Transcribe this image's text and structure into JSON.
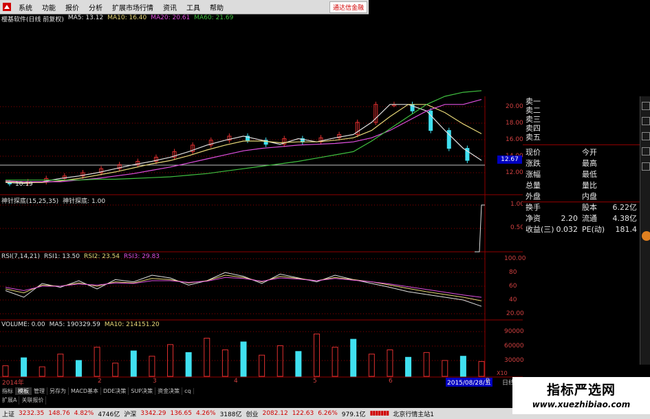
{
  "menu": {
    "items": [
      "系统",
      "功能",
      "报价",
      "分析",
      "扩展市场行情",
      "资讯",
      "工具",
      "帮助"
    ],
    "brand": "通达信金融"
  },
  "main": {
    "title": "樱基软件(日线 前复权)",
    "ma": [
      {
        "label": "MA5: 13.12",
        "color": "#e0e0e0"
      },
      {
        "label": "MA10: 16.40",
        "color": "#e8d878"
      },
      {
        "label": "MA20: 20.61",
        "color": "#e050e0"
      },
      {
        "label": "MA60: 21.69",
        "color": "#40c040"
      }
    ],
    "price_ticks": [
      "20.00",
      "18.00",
      "16.00",
      "14.00",
      "12.00"
    ],
    "current_price": "12.67",
    "low_label": "10.19"
  },
  "indicator1": {
    "title": "神针探底(15,25,35)",
    "value_label": "神针探底: 1.00",
    "ticks": [
      "1.00",
      "0.50"
    ]
  },
  "rsi": {
    "title": "RSI(7,14,21)",
    "rsi1": "RSI1: 13.50",
    "rsi2": "RSI2: 23.54",
    "rsi3": "RSI3: 29.83",
    "ticks": [
      "100.00",
      "80",
      "60",
      "40",
      "20.00"
    ]
  },
  "volume": {
    "title": "VOLUME: 0.00",
    "ma5": "MA5: 190329.59",
    "ma10": "MA10: 214151.20",
    "ticks": [
      "90000",
      "60000",
      "30000"
    ],
    "unit": "X10"
  },
  "xaxis": {
    "labels": [
      "2014年",
      "2",
      "3",
      "4",
      "5",
      "6"
    ],
    "date": "2015/08/28/五",
    "d": "B",
    "day": "日线"
  },
  "orderbook": {
    "labels": [
      "卖一",
      "卖二",
      "卖三",
      "卖四",
      "卖五"
    ]
  },
  "quote": {
    "rows": [
      {
        "l1": "现价",
        "v1": "",
        "l2": "今开",
        "v2": ""
      },
      {
        "l1": "涨跌",
        "v1": "",
        "l2": "最高",
        "v2": ""
      },
      {
        "l1": "涨幅",
        "v1": "",
        "l2": "最低",
        "v2": ""
      },
      {
        "l1": "总量",
        "v1": "",
        "l2": "量比",
        "v2": ""
      },
      {
        "l1": "外盘",
        "v1": "",
        "l2": "内盘",
        "v2": ""
      },
      {
        "l1": "换手",
        "v1": "",
        "l2": "股本",
        "v2": "6.22亿"
      },
      {
        "l1": "净资",
        "v1": "2.20",
        "l2": "流通",
        "v2": "4.38亿"
      },
      {
        "l1": "收益(三)",
        "v1": "0.032",
        "l2": "PE(动)",
        "v2": "181.4"
      }
    ]
  },
  "tabs": {
    "row1": [
      "指标",
      "模板",
      "管理",
      "另存为",
      "MACD基本",
      "DDE决策",
      "SUP决策",
      "资金决策",
      "cq"
    ],
    "active": "模板",
    "row2": [
      "扩展A",
      "关联报价"
    ]
  },
  "status": {
    "items": [
      {
        "name": "上证",
        "value": "3232.35",
        "chg": "148.76",
        "pct": "4.82%",
        "vol": "4746亿"
      },
      {
        "name": "沪深",
        "value": "3342.29",
        "chg": "136.65",
        "pct": "4.26%",
        "vol": "3188亿"
      },
      {
        "name": "创业",
        "value": "2082.12",
        "chg": "122.63",
        "pct": "6.26%",
        "vol": "979.1亿"
      }
    ],
    "server": "北京行情主站1"
  },
  "watermark": {
    "title": "指标严选网",
    "url": "www.xuezhibiao.com"
  },
  "colors": {
    "up": "#e03030",
    "down": "#40e0f0",
    "ma60": "#40c040",
    "ma20": "#e050e0",
    "ma10": "#e8d878",
    "grid": "#900000"
  },
  "chart_data": [
    {
      "type": "line",
      "title": "",
      "ylim": [
        10,
        21
      ],
      "series": [
        {
          "name": "MA5",
          "values": [
            10.4,
            10.3,
            10.5,
            10.9,
            11.2,
            11.6,
            12.1,
            12.6,
            13.0,
            13.5,
            14.2,
            15.0,
            15.6,
            16.1,
            15.6,
            15.1,
            15.8,
            15.4,
            15.9,
            16.3,
            17.8,
            20.0,
            20.0,
            19.2,
            16.8,
            14.6,
            13.12
          ]
        },
        {
          "name": "MA10",
          "values": [
            10.5,
            10.4,
            10.4,
            10.6,
            10.9,
            11.3,
            11.7,
            12.2,
            12.7,
            13.1,
            13.7,
            14.4,
            15.0,
            15.5,
            15.5,
            15.3,
            15.4,
            15.4,
            15.6,
            15.9,
            16.8,
            18.5,
            20.0,
            20.0,
            19.0,
            17.6,
            16.4
          ]
        },
        {
          "name": "MA20",
          "values": [
            10.6,
            10.5,
            10.5,
            10.5,
            10.7,
            10.9,
            11.2,
            11.5,
            11.9,
            12.3,
            12.8,
            13.3,
            13.8,
            14.3,
            14.6,
            14.8,
            15.0,
            15.1,
            15.2,
            15.4,
            15.9,
            16.8,
            18.0,
            19.2,
            20.0,
            20.0,
            20.61
          ]
        },
        {
          "name": "MA60",
          "values": [
            10.7,
            10.7,
            10.7,
            10.7,
            10.7,
            10.8,
            10.8,
            10.9,
            11.0,
            11.1,
            11.3,
            11.5,
            11.8,
            12.1,
            12.4,
            12.7,
            13.0,
            13.4,
            13.8,
            14.2,
            15.5,
            17.0,
            18.5,
            20.0,
            21.0,
            21.5,
            21.69
          ]
        }
      ]
    },
    {
      "type": "line",
      "title": "",
      "ylim": [
        0,
        100
      ],
      "series": [
        {
          "name": "RSI1",
          "values": [
            42,
            30,
            55,
            48,
            60,
            45,
            62,
            58,
            70,
            65,
            52,
            60,
            75,
            68,
            55,
            72,
            65,
            58,
            70,
            62,
            55,
            48,
            40,
            35,
            30,
            25,
            13.5
          ]
        },
        {
          "name": "RSI2",
          "values": [
            45,
            38,
            52,
            50,
            56,
            50,
            58,
            56,
            64,
            62,
            56,
            60,
            70,
            66,
            58,
            68,
            64,
            60,
            66,
            62,
            58,
            52,
            46,
            40,
            35,
            30,
            23.54
          ]
        },
        {
          "name": "RSI3",
          "values": [
            48,
            42,
            50,
            50,
            54,
            52,
            56,
            55,
            60,
            60,
            57,
            59,
            66,
            64,
            59,
            65,
            63,
            60,
            64,
            61,
            58,
            54,
            49,
            44,
            39,
            34,
            29.83
          ]
        }
      ]
    },
    {
      "type": "bar",
      "title": "",
      "ylim": [
        0,
        100000
      ],
      "series": [
        {
          "name": "VOLUME",
          "values": [
            20000,
            35000,
            18000,
            42000,
            30000,
            55000,
            25000,
            48000,
            38000,
            60000,
            45000,
            72000,
            50000,
            65000,
            40000,
            58000,
            47000,
            80000,
            55000,
            70000,
            42000,
            50000,
            36000,
            45000,
            30000,
            38000,
            28000
          ]
        }
      ]
    }
  ]
}
